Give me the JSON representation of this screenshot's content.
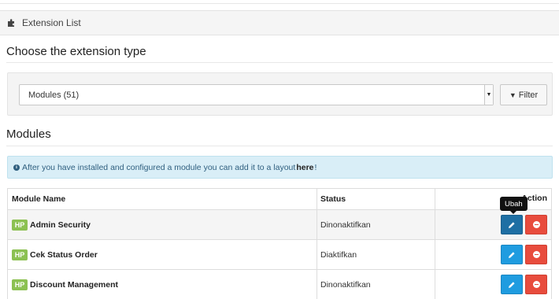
{
  "panel": {
    "title": "Extension List",
    "icon": "puzzle-icon"
  },
  "choose": {
    "heading": "Choose the extension type",
    "select_value": "Modules (51)",
    "filter_label": "Filter",
    "filter_icon": "filter-icon"
  },
  "modules": {
    "heading": "Modules",
    "alert": {
      "icon": "info-circle-icon",
      "text_before": "After you have installed and configured a module you can add it to a layout",
      "link": "here",
      "text_after": "!"
    },
    "table": {
      "headers": {
        "name": "Module Name",
        "status": "Status",
        "action": "Action"
      },
      "badge": "HP",
      "rows": [
        {
          "name": "Admin Security",
          "status": "Dinonaktifkan"
        },
        {
          "name": "Cek Status Order",
          "status": "Diaktifkan"
        },
        {
          "name": "Discount Management",
          "status": "Dinonaktifkan"
        }
      ]
    },
    "tooltip": "Ubah"
  },
  "colors": {
    "edit_button": "#1f9ce0",
    "edit_button_active": "#1e6fa4",
    "delete_button": "#e84c3d",
    "badge": "#8cc152",
    "alert_bg": "#d9eef7"
  }
}
